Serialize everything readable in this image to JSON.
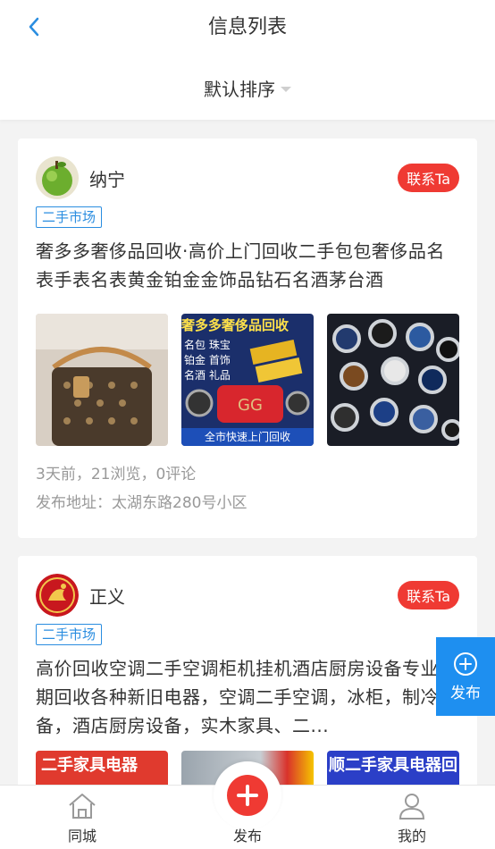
{
  "header": {
    "title": "信息列表",
    "sort_label": "默认排序"
  },
  "posts": [
    {
      "username": "纳宁",
      "contact_label": "联系Ta",
      "tag": "二手市场",
      "description": "奢多多奢侈品回收·高价上门回收二手包包奢侈品名表手表名表黄金铂金金饰品钻石名酒茅台酒",
      "image_texts": {
        "banner": "奢多多奢侈品回收",
        "line1": "名包 珠宝",
        "line2": "铂金 首饰",
        "line3": "名酒 礼品",
        "footer": "全市快速上门回收"
      },
      "stats": "3天前，21浏览，0评论",
      "address": "发布地址：太湖东路280号小区"
    },
    {
      "username": "正义",
      "contact_label": "联系Ta",
      "tag": "二手市场",
      "description": "高价回收空调二手空调柜机挂机酒店厨房设备专业长期回收各种新旧电器，空调二手空调，冰柜，制冷设备，酒店厨房设备，实木家具、二...",
      "image_texts": {
        "left": "二手家具电器",
        "right": "顺二手家具电器回"
      }
    }
  ],
  "fab": {
    "label": "发布"
  },
  "tabbar": {
    "home": "同城",
    "publish": "发布",
    "mine": "我的"
  },
  "colors": {
    "accent_blue": "#1e8ff0",
    "contact_red": "#ef3a33",
    "tag_blue": "#2a8de0"
  }
}
